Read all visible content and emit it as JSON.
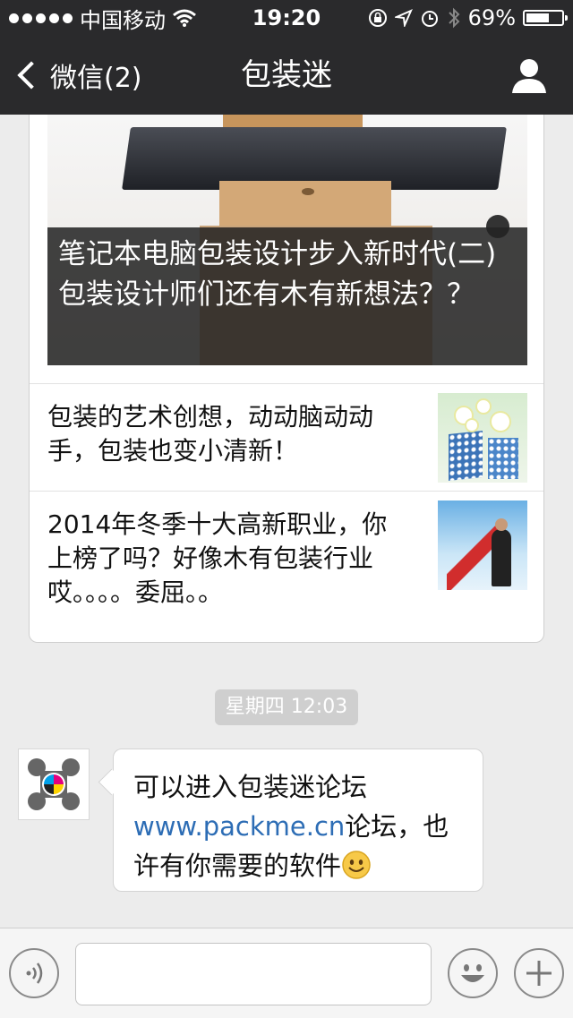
{
  "status_bar": {
    "carrier": "中国移动",
    "time": "19:20",
    "battery_percent": "69%",
    "battery_level": 0.69,
    "icons": [
      "signal-dots-icon",
      "wifi-icon",
      "rotation-lock-icon",
      "location-icon",
      "alarm-icon",
      "bluetooth-icon",
      "battery-icon"
    ]
  },
  "nav": {
    "back_label": "微信(2)",
    "title": "包装迷",
    "profile_icon": "person-icon"
  },
  "article_card": {
    "cover_title": "笔记本电脑包装设计步入新时代(二) 包装设计师们还有木有新想法？？",
    "items": [
      {
        "title": "包装的艺术创想，动动脑动动手，包装也变小清新！",
        "thumb_icon": "flower-pots-thumbnail"
      },
      {
        "title": "2014年冬季十大高新职业，你上榜了吗？好像木有包装行业哎。。。。委屈。。",
        "thumb_icon": "businessman-stairs-thumbnail"
      }
    ]
  },
  "timestamp": "星期四 12:03",
  "message": {
    "avatar_icon": "packme-logo-icon",
    "text_before": "可以进入包装迷论坛",
    "link": "www.packme.cn",
    "text_after": "论坛，也许有你需要的软件",
    "emoji": "smiley-icon"
  },
  "input_bar": {
    "voice_icon": "voice-icon",
    "emoji_icon": "emoji-icon",
    "plus_icon": "plus-icon",
    "input_value": ""
  },
  "colors": {
    "bar_bg": "#2a2a2c",
    "chat_bg": "#ececec",
    "link": "#2d6db5"
  }
}
